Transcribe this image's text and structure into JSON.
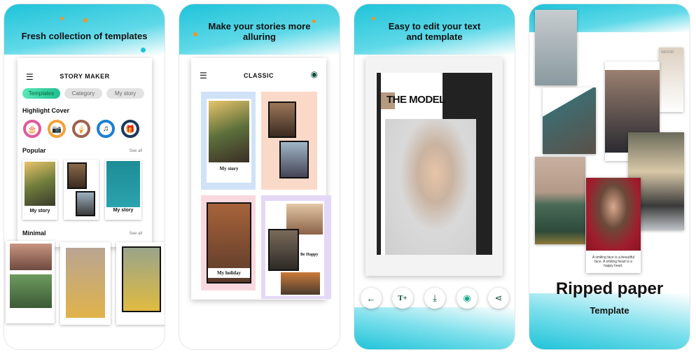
{
  "panel1": {
    "title": "Fresh collection of templates",
    "app_title": "STORY MAKER",
    "tabs": [
      "Templates",
      "Category",
      "My story"
    ],
    "highlight_cover": "Highlight Cover",
    "highlight_icons": [
      "cake-icon",
      "camera-icon",
      "ice-cream-icon",
      "music-icon",
      "gift-icon"
    ],
    "popular": "Popular",
    "see_all": "See all",
    "popular_items": [
      "My story",
      "My story"
    ],
    "minimal": "Minimal",
    "see_all_2": "See all"
  },
  "panel2": {
    "title": "Make your stories more alluring",
    "header": "CLASSIC",
    "templates": [
      "My story",
      "My holiday",
      "Be Happy"
    ]
  },
  "panel3": {
    "title": "Easy to edit your text and template",
    "headline": "THE MODEL",
    "tools": [
      "back-arrow-icon",
      "add-text-icon",
      "download-icon",
      "preview-eye-icon",
      "share-icon"
    ]
  },
  "panel4": {
    "mood": "MOOD",
    "quote": "A smiling face is a beautiful face. A smiling heart is a happy heart.",
    "title": "Ripped paper",
    "subtitle": "Template"
  },
  "colors": {
    "accent": "#1fc3d9",
    "tab_active": "#2fd3a0",
    "splash": "#f7941d"
  }
}
